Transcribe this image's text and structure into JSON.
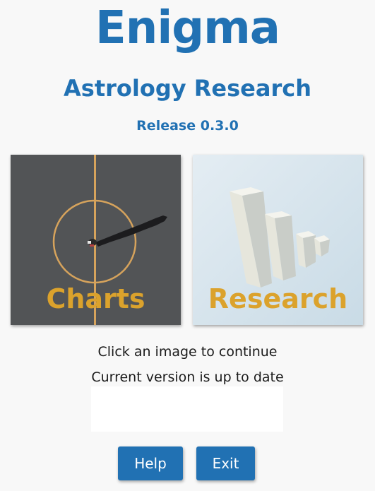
{
  "header": {
    "title": "Enigma",
    "subtitle": "Astrology Research",
    "release": "Release 0.3.0"
  },
  "tiles": [
    {
      "label": "Charts",
      "image": "aerial-shadow-circle-image"
    },
    {
      "label": "Research",
      "image": "ascending-bars-image"
    }
  ],
  "messages": {
    "instruction": "Click an image to continue",
    "version_status": "Current version is up to date"
  },
  "buttons": {
    "help_label": "Help",
    "exit_label": "Exit"
  },
  "colors": {
    "accent": "#2171b3",
    "tile_label": "#dba22c",
    "background": "#f8f8f8"
  }
}
